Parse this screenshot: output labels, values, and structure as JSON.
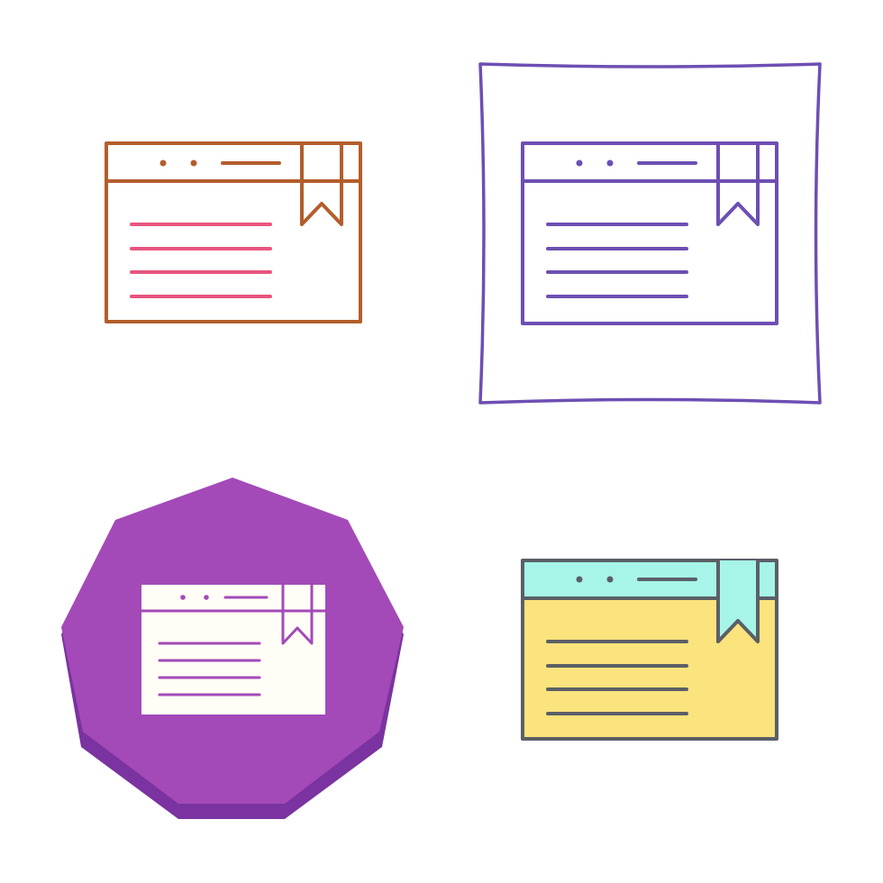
{
  "background": "#ffffff",
  "icons": [
    {
      "name": "bookmarked-webpage-icon-line",
      "style": "line",
      "colors": {
        "frame": "#b35e2c",
        "text_lines": "#e8557f"
      }
    },
    {
      "name": "bookmarked-webpage-icon-boxed",
      "style": "boxed-outline",
      "colors": {
        "frame": "#6d4fb3",
        "text_lines": "#6d4fb3",
        "box": "#6d4fb3"
      }
    },
    {
      "name": "bookmarked-webpage-icon-glyph",
      "style": "octagon-badge",
      "colors": {
        "badge": "#a34ab8",
        "badge_shadow": "#7a33a0",
        "page": "#fffdf6",
        "text_lines": "#a34ab8"
      }
    },
    {
      "name": "bookmarked-webpage-icon-filled",
      "style": "filled",
      "colors": {
        "frame": "#5b5f66",
        "header_fill": "#a6f5e8",
        "body_fill": "#fbe37d",
        "bookmark_fill": "#a6f5e8",
        "text_lines": "#5b5f66"
      }
    }
  ]
}
